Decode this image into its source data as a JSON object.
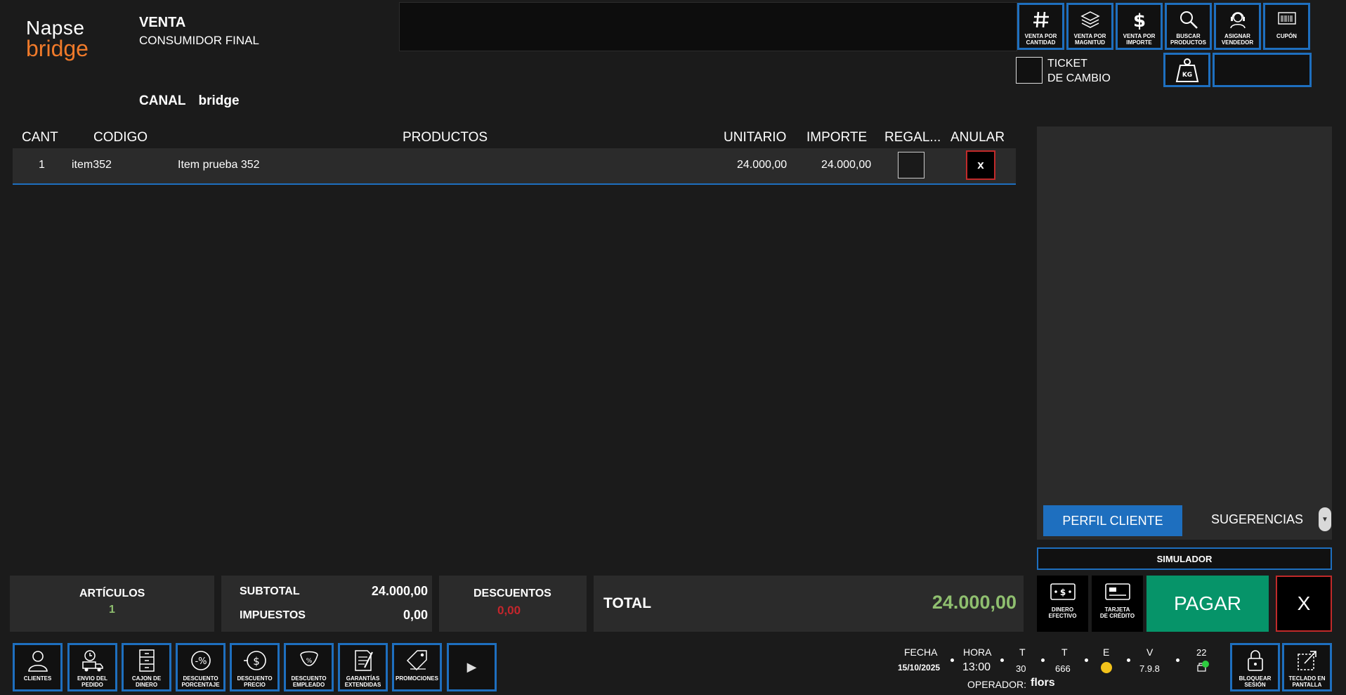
{
  "logo": {
    "line1": "Napse",
    "line2": "bridge"
  },
  "header": {
    "title": "VENTA",
    "subtitle": "CONSUMIDOR FINAL",
    "canal_label": "CANAL",
    "canal_value": "bridge"
  },
  "toolbar": {
    "buttons": [
      {
        "label": "VENTA POR CANTIDAD",
        "icon": "hash-icon"
      },
      {
        "label": "VENTA POR MAGNITUD",
        "icon": "layers-icon"
      },
      {
        "label": "VENTA POR IMPORTE",
        "icon": "dollar-icon"
      },
      {
        "label": "BUSCAR PRODUCTOS",
        "icon": "search-icon"
      },
      {
        "label": "ASIGNAR VENDEDOR",
        "icon": "headset-icon"
      },
      {
        "label": "CUPÓN",
        "icon": "barcode-icon"
      }
    ],
    "ticket_line1": "TICKET",
    "ticket_line2": "DE CAMBIO",
    "kg_label": "KG"
  },
  "table": {
    "headers": [
      "CANT",
      "CODIGO",
      "PRODUCTOS",
      "UNITARIO",
      "IMPORTE",
      "REGAL...",
      "ANULAR"
    ],
    "rows": [
      {
        "cant": "1",
        "codigo": "item352",
        "producto": "Item prueba 352",
        "unitario": "24.000,00",
        "importe": "24.000,00",
        "anular": "x"
      }
    ]
  },
  "right_panel": {
    "tab_active": "PERFIL CLIENTE",
    "tab_2": "SUGERENCIAS",
    "simulador": "SIMULADOR"
  },
  "payment": {
    "cash_label_1": "DINERO",
    "cash_label_2": "EFECTIVO",
    "card_label_1": "TARJETA",
    "card_label_2": "DE CRÉDITO",
    "pagar": "PAGAR",
    "cancel": "X"
  },
  "totals": {
    "articulos_label": "ARTÍCULOS",
    "articulos_value": "1",
    "subtotal_label": "SUBTOTAL",
    "subtotal_value": "24.000,00",
    "impuestos_label": "IMPUESTOS",
    "impuestos_value": "0,00",
    "descuentos_label": "DESCUENTOS",
    "descuentos_value": "0,00",
    "total_label": "TOTAL",
    "total_value": "24.000,00"
  },
  "bottom_buttons": [
    {
      "label1": "CLIENTES",
      "label2": "",
      "icon": "user-icon"
    },
    {
      "label1": "ENVIO DEL",
      "label2": "PEDIDO",
      "icon": "truck-icon"
    },
    {
      "label1": "CAJON DE",
      "label2": "DINERO",
      "icon": "drawer-icon"
    },
    {
      "label1": "DESCUENTO",
      "label2": "PORCENTAJE",
      "icon": "percent-icon"
    },
    {
      "label1": "DESCUENTO",
      "label2": "PRECIO",
      "icon": "price-discount-icon"
    },
    {
      "label1": "DESCUENTO",
      "label2": "EMPLEADO",
      "icon": "employee-discount-icon"
    },
    {
      "label1": "GARANTÍAS",
      "label2": "EXTENDIDAS",
      "icon": "document-icon"
    },
    {
      "label1": "PROMOCIONES",
      "label2": "",
      "icon": "tag-icon"
    }
  ],
  "status": {
    "fecha_label": "FECHA",
    "fecha_value": "15/10/2025",
    "hora_label": "HORA",
    "hora_value": "13:00",
    "t1_label": "T",
    "t1_value": "30",
    "t2_label": "T",
    "t2_value": "666",
    "e_label": "E",
    "v_label": "V",
    "v_value": "7.9.8",
    "count_value": "22",
    "operador_label": "OPERADOR:",
    "operador_value": "flors",
    "e_status_color": "#f2c21b"
  },
  "session_buttons": [
    {
      "label1": "BLOQUEAR",
      "label2": "SESIÓN",
      "icon": "lock-icon"
    },
    {
      "label1": "TECLADO EN",
      "label2": "PANTALLA",
      "icon": "keyboard-icon"
    }
  ],
  "colors": {
    "accent": "#1e6fbf",
    "brand": "#f07a2a",
    "pay": "#069469",
    "danger": "#c12a2a",
    "green_value": "#8fbf6f",
    "red_value": "#c4262c"
  }
}
